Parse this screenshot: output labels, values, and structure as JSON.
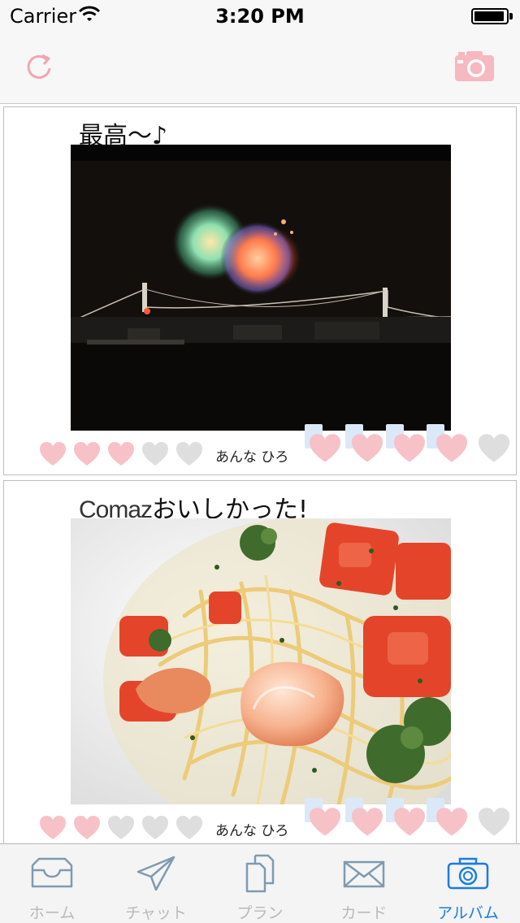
{
  "status_bar": {
    "carrier": "Carrier",
    "time": "3:20 PM"
  },
  "nav": {
    "reload_icon": "reload-icon",
    "camera_icon": "camera-icon"
  },
  "colors": {
    "accent": "#f2a6b0",
    "tab_active": "#1a7ce4",
    "heart_on": "#f6c2c8",
    "heart_off": "#dedede"
  },
  "posts": [
    {
      "title": "最高〜♪",
      "brand": "",
      "photo": "fireworks-over-bridge",
      "rating": 3,
      "rating_max": 5,
      "members": "あんな ひろ",
      "reactions": [
        true,
        true,
        true,
        true,
        false
      ]
    },
    {
      "title": "おいしかった!",
      "brand": "Comaz",
      "photo": "shrimp-tomato-pasta",
      "rating": 2,
      "rating_max": 5,
      "members": "あんな ひろ",
      "reactions": [
        true,
        true,
        true,
        true,
        false
      ]
    }
  ],
  "tabs": [
    {
      "label": "ホーム",
      "icon": "inbox-icon",
      "active": false
    },
    {
      "label": "チャット",
      "icon": "paper-plane-icon",
      "active": false
    },
    {
      "label": "プラン",
      "icon": "documents-icon",
      "active": false
    },
    {
      "label": "カード",
      "icon": "envelope-icon",
      "active": false
    },
    {
      "label": "アルバム",
      "icon": "camera-icon",
      "active": true
    }
  ]
}
